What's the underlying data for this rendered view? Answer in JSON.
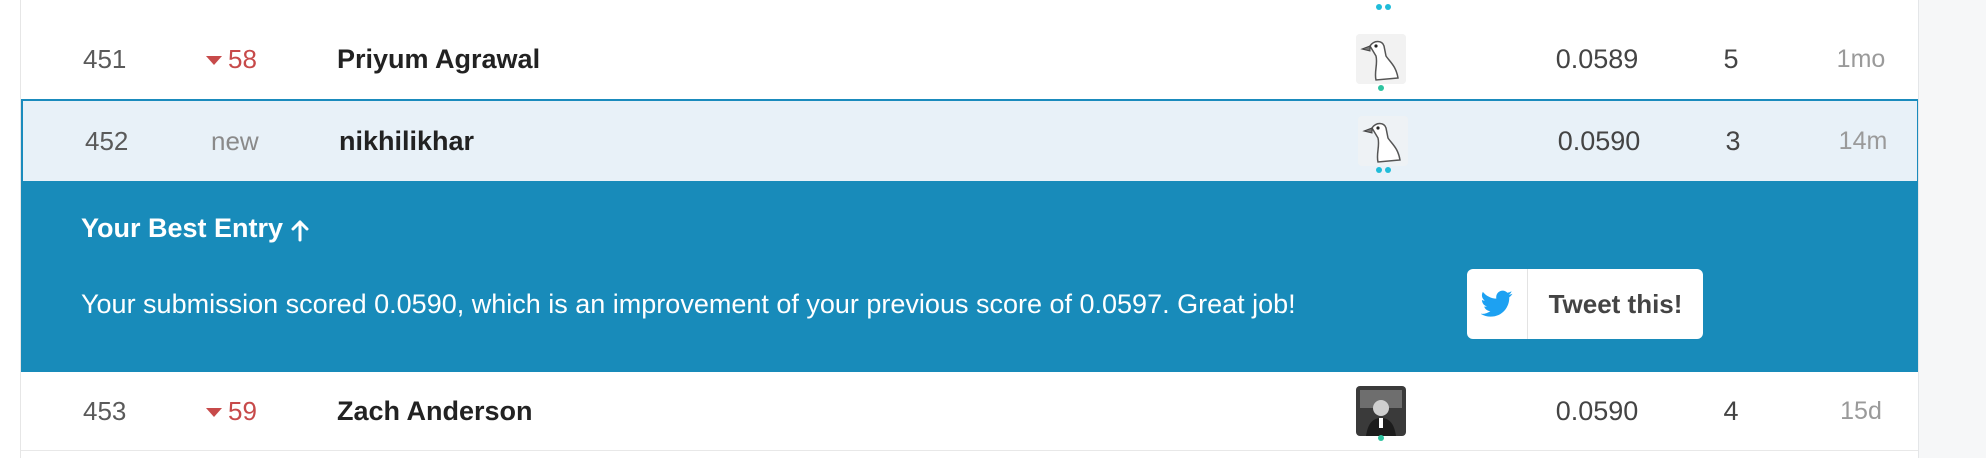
{
  "leaderboard": {
    "rows": [
      {
        "rank": "451",
        "delta": "58",
        "delta_dir": "down",
        "name": "Priyum Agrawal",
        "avatar_icon": "goose-avatar-icon",
        "score": "0.0589",
        "entries": "5",
        "last": "1mo"
      },
      {
        "rank": "452",
        "delta": "new",
        "delta_dir": "new",
        "name": "nikhilikhar",
        "avatar_icon": "goose-avatar-icon",
        "score": "0.0590",
        "entries": "3",
        "last": "14m"
      },
      {
        "rank": "453",
        "delta": "59",
        "delta_dir": "down",
        "name": "Zach Anderson",
        "avatar_icon": "user-photo-avatar",
        "score": "0.0590",
        "entries": "4",
        "last": "15d"
      }
    ]
  },
  "best_entry": {
    "title": "Your Best Entry",
    "message": "Your submission scored 0.0590, which is an improvement of your previous score of 0.0597. Great job!",
    "tweet_label": "Tweet this!"
  },
  "colors": {
    "banner": "#188bba",
    "highlight_row": "#e8f1f8",
    "highlight_border": "#1a8bbd",
    "down": "#c74a4a",
    "twitter": "#1da1f2"
  }
}
